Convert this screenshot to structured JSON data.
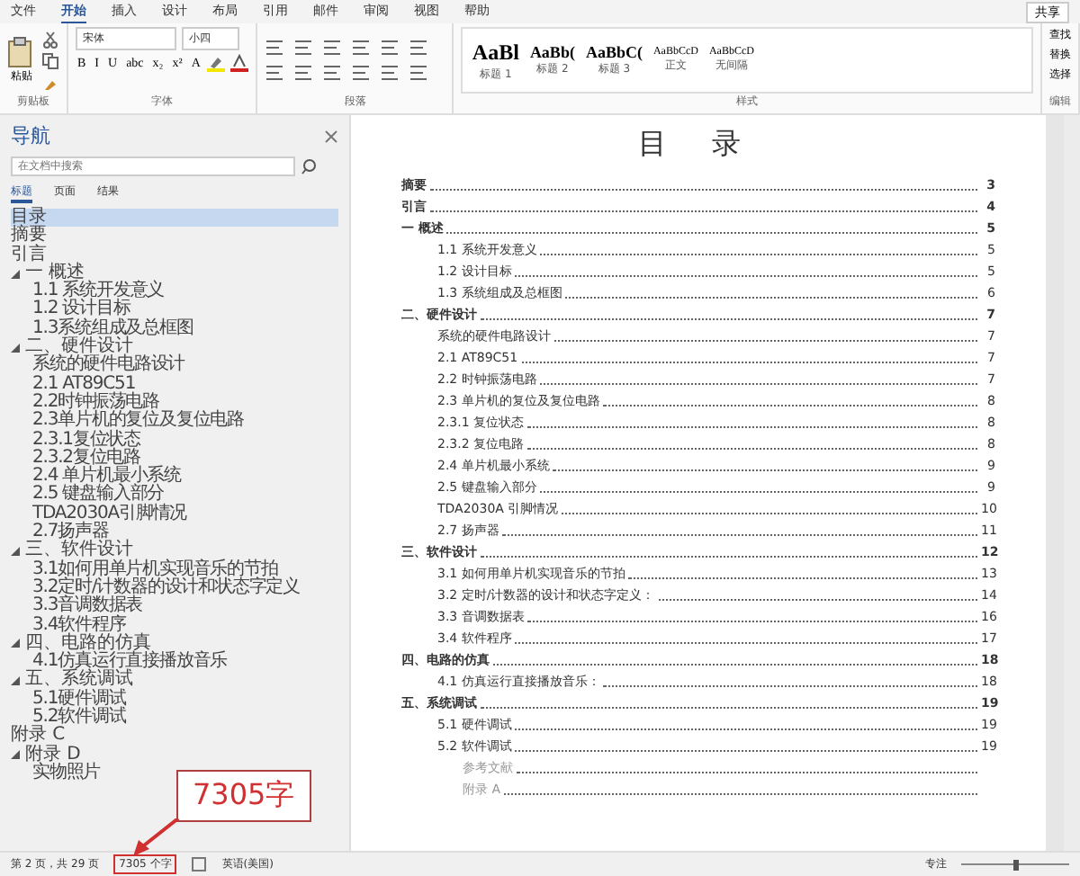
{
  "ribbon_tabs": [
    {
      "label": "文件",
      "selected": false
    },
    {
      "label": "开始",
      "selected": true
    },
    {
      "label": "插入",
      "selected": false
    },
    {
      "label": "设计",
      "selected": false
    },
    {
      "label": "布局",
      "selected": false
    },
    {
      "label": "引用",
      "selected": false
    },
    {
      "label": "邮件",
      "selected": false
    },
    {
      "label": "审阅",
      "selected": false
    },
    {
      "label": "视图",
      "selected": false
    },
    {
      "label": "帮助",
      "selected": false
    }
  ],
  "share": "共享",
  "clipboard": {
    "paste": "粘贴",
    "group": "剪贴板"
  },
  "font": {
    "name": "宋体",
    "size": "小四",
    "buttons": [
      "B",
      "I",
      "U",
      "abc",
      "x₂",
      "x²",
      "A"
    ],
    "group": "字体"
  },
  "paragraph": {
    "group": "段落"
  },
  "styles": {
    "group": "样式",
    "items": [
      {
        "sample": "AaBl",
        "label": "标题 1"
      },
      {
        "sample": "AaBb(",
        "label": "标题 2"
      },
      {
        "sample": "AaBbC(",
        "label": "标题 3"
      },
      {
        "sample": "AaBbCcD",
        "label": "正文"
      },
      {
        "sample": "AaBbCcD",
        "label": "无间隔"
      }
    ]
  },
  "editing": {
    "group": "编辑",
    "items": [
      "查找",
      "替换",
      "选择"
    ]
  },
  "nav": {
    "title": "导航",
    "search_placeholder": "在文档中搜索",
    "tabs": [
      {
        "label": "标题",
        "selected": true
      },
      {
        "label": "页面",
        "selected": false
      },
      {
        "label": "结果",
        "selected": false
      }
    ],
    "items": [
      {
        "label": "目录",
        "selected": true
      },
      {
        "label": "摘要",
        "selected": false
      },
      {
        "label": "引言",
        "selected": false
      },
      {
        "label": "一 概述",
        "selected": false,
        "expanded": true,
        "children": [
          {
            "label": "1.1 系统开发意义",
            "selected": false
          },
          {
            "label": "1.2 设计目标",
            "selected": false
          },
          {
            "label": "1.3系统组成及总框图",
            "selected": false
          }
        ]
      },
      {
        "label": "二、硬件设计",
        "selected": false,
        "expanded": true,
        "children": [
          {
            "label": "系统的硬件电路设计",
            "selected": false
          },
          {
            "label": "2.1 AT89C51",
            "selected": false
          },
          {
            "label": "2.2时钟振荡电路",
            "selected": false
          },
          {
            "label": "2.3单片机的复位及复位电路",
            "selected": false
          },
          {
            "label": "2.3.1复位状态",
            "selected": false
          },
          {
            "label": "2.3.2复位电路",
            "selected": false
          },
          {
            "label": "2.4 单片机最小系统",
            "selected": false
          },
          {
            "label": "2.5 键盘输入部分",
            "selected": false
          },
          {
            "label": "TDA2030A引脚情况",
            "selected": false
          },
          {
            "label": "2.7扬声器",
            "selected": false
          }
        ]
      },
      {
        "label": "三、软件设计",
        "selected": false,
        "expanded": true,
        "children": [
          {
            "label": "3.1如何用单片机实现音乐的节拍",
            "selected": false
          },
          {
            "label": "3.2定时/计数器的设计和状态字定义",
            "selected": false
          },
          {
            "label": "3.3音调数据表",
            "selected": false
          },
          {
            "label": "3.4软件程序",
            "selected": false
          }
        ]
      },
      {
        "label": "四、电路的仿真",
        "selected": false,
        "expanded": true,
        "children": [
          {
            "label": "4.1仿真运行直接播放音乐",
            "selected": false
          }
        ]
      },
      {
        "label": "五、系统调试",
        "selected": false,
        "expanded": true,
        "children": [
          {
            "label": "5.1硬件调试",
            "selected": false
          },
          {
            "label": "5.2软件调试",
            "selected": false
          }
        ]
      },
      {
        "label": "附录 C",
        "selected": false
      },
      {
        "label": "附录 D",
        "selected": false,
        "expanded": true,
        "children": [
          {
            "label": "实物照片",
            "selected": false
          }
        ]
      }
    ]
  },
  "toc": {
    "title": "目 录",
    "entries": [
      {
        "kind": "chapter",
        "text": "摘要",
        "page": "3"
      },
      {
        "kind": "chapter",
        "text": "引言",
        "page": "4"
      },
      {
        "kind": "chapter",
        "text": "一 概述",
        "page": "5"
      },
      {
        "kind": "section",
        "text": "1.1 系统开发意义",
        "page": "5"
      },
      {
        "kind": "section",
        "text": "1.2 设计目标",
        "page": "5"
      },
      {
        "kind": "section",
        "text": "1.3 系统组成及总框图",
        "page": "6"
      },
      {
        "kind": "chapter",
        "text": "二、硬件设计",
        "page": "7"
      },
      {
        "kind": "section",
        "text": "系统的硬件电路设计",
        "page": "7"
      },
      {
        "kind": "section",
        "text": "2.1 AT89C51",
        "page": "7"
      },
      {
        "kind": "section",
        "text": "2.2 时钟振荡电路",
        "page": "7"
      },
      {
        "kind": "section",
        "text": "2.3 单片机的复位及复位电路",
        "page": "8"
      },
      {
        "kind": "section",
        "text": "2.3.1 复位状态",
        "page": "8"
      },
      {
        "kind": "section",
        "text": "2.3.2 复位电路",
        "page": "8"
      },
      {
        "kind": "section",
        "text": "2.4 单片机最小系统",
        "page": "9"
      },
      {
        "kind": "section",
        "text": "2.5 键盘输入部分",
        "page": "9"
      },
      {
        "kind": "section",
        "text": "TDA2030A 引脚情况",
        "page": "10"
      },
      {
        "kind": "section",
        "text": "2.7 扬声器",
        "page": "11"
      },
      {
        "kind": "chapter",
        "text": "三、软件设计",
        "page": "12"
      },
      {
        "kind": "section",
        "text": "3.1 如何用单片机实现音乐的节拍",
        "page": "13"
      },
      {
        "kind": "section",
        "text": "3.2 定时/计数器的设计和状态字定义：",
        "page": "14"
      },
      {
        "kind": "section",
        "text": "3.3 音调数据表",
        "page": "16"
      },
      {
        "kind": "section",
        "text": "3.4 软件程序",
        "page": "17"
      },
      {
        "kind": "chapter",
        "text": "四、电路的仿真",
        "page": "18"
      },
      {
        "kind": "section",
        "text": "4.1 仿真运行直接播放音乐：",
        "page": "18"
      },
      {
        "kind": "chapter",
        "text": "五、系统调试",
        "page": "19"
      },
      {
        "kind": "section",
        "text": "5.1 硬件调试",
        "page": "19"
      },
      {
        "kind": "section",
        "text": "5.2 软件调试",
        "page": "19"
      },
      {
        "kind": "appendix",
        "text": "参考文献"
      },
      {
        "kind": "appendix",
        "text": "附录 A"
      }
    ]
  },
  "status_bar": {
    "page": "第 2 页，共 29 页",
    "words": "7305 个字",
    "language": "英语(美国)",
    "view": "专注",
    "zoom": {
      "level": 0.5
    }
  },
  "callout": "7305字"
}
